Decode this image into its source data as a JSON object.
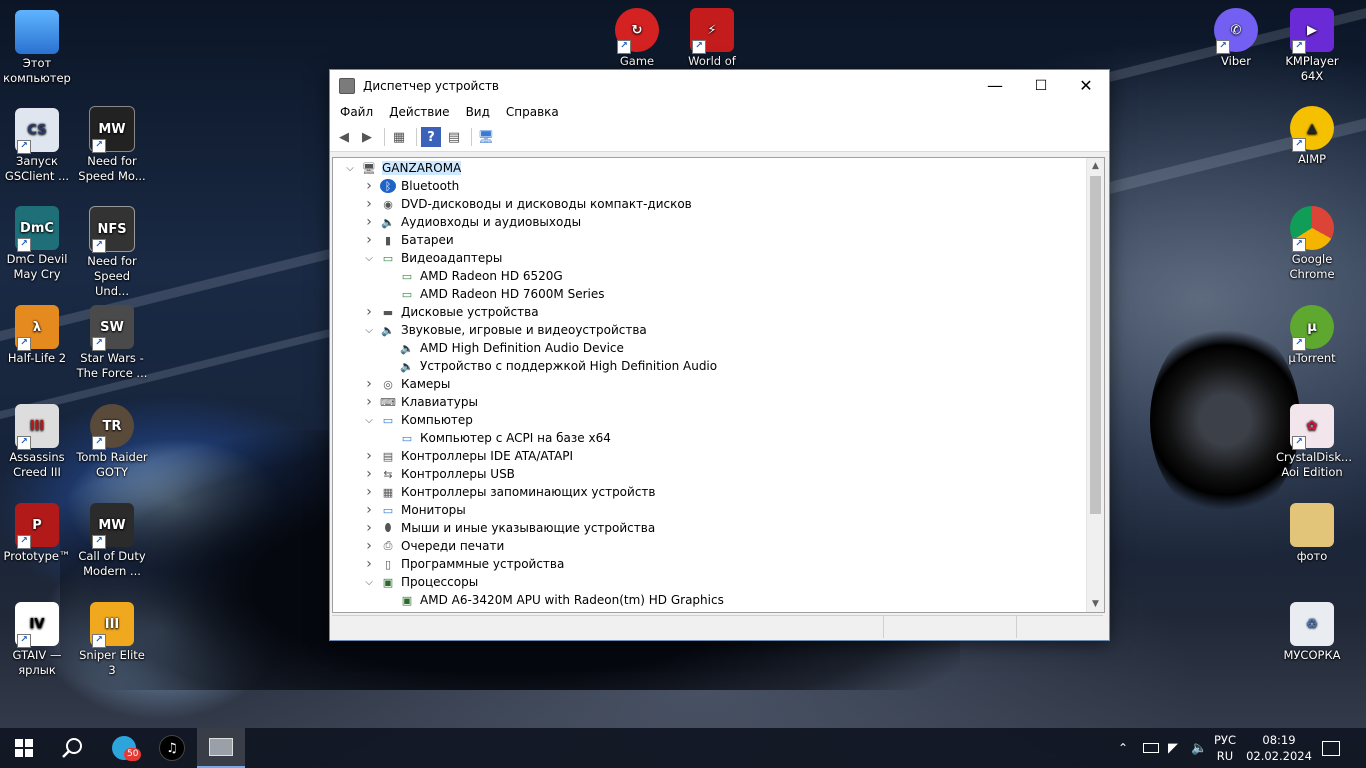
{
  "desktop": {
    "left_icons": [
      {
        "line1": "Этот",
        "line2": "компьютер",
        "icon": "computer-icon"
      },
      {
        "line1": "Запуск",
        "line2": "GSClient ...",
        "icon": "gsclient-icon"
      },
      {
        "line1": "Need for",
        "line2": "Speed Mo...",
        "icon": "nfs-most-wanted-icon"
      },
      {
        "line1": "DmC Devil",
        "line2": "May Cry",
        "icon": "dmc-icon"
      },
      {
        "line1": "Need for",
        "line2": "Speed Und...",
        "icon": "nfs-underground-icon"
      },
      {
        "line1": "Half-Life 2",
        "line2": "",
        "icon": "half-life-icon"
      },
      {
        "line1": "Star Wars -",
        "line2": "The Force ...",
        "icon": "star-wars-icon"
      },
      {
        "line1": "Assassins",
        "line2": "Creed III",
        "icon": "assassins-creed-icon"
      },
      {
        "line1": "Tomb Raider",
        "line2": "GOTY",
        "icon": "tomb-raider-icon"
      },
      {
        "line1": "Prototype™",
        "line2": "",
        "icon": "prototype-icon"
      },
      {
        "line1": "Call of Duty",
        "line2": "Modern ...",
        "icon": "call-of-duty-icon"
      },
      {
        "line1": "GTAIV —",
        "line2": "ярлык",
        "icon": "gta-iv-icon"
      },
      {
        "line1": "Sniper Elite 3",
        "line2": "",
        "icon": "sniper-elite-icon"
      }
    ],
    "top_icons": [
      {
        "line1": "Game Center",
        "line2": "",
        "icon": "game-center-icon"
      },
      {
        "line1": "World of",
        "line2": "",
        "icon": "world-of-tanks-icon"
      }
    ],
    "right_icons": [
      {
        "line1": "Viber",
        "line2": "",
        "icon": "viber-icon"
      },
      {
        "line1": "KMPlayer",
        "line2": "64X",
        "icon": "kmplayer-icon"
      },
      {
        "line1": "AIMP",
        "line2": "",
        "icon": "aimp-icon"
      },
      {
        "line1": "Google",
        "line2": "Chrome",
        "icon": "chrome-icon"
      },
      {
        "line1": "µTorrent",
        "line2": "",
        "icon": "utorrent-icon"
      },
      {
        "line1": "CrystalDisk...",
        "line2": "Aoi Edition",
        "icon": "crystaldisk-icon"
      },
      {
        "line1": "фото",
        "line2": "",
        "icon": "photo-folder-icon"
      },
      {
        "line1": "МУСОРКА",
        "line2": "",
        "icon": "recycle-bin-icon"
      }
    ]
  },
  "window": {
    "title": "Диспетчер устройств",
    "minimize": "—",
    "maximize": "☐",
    "close": "✕",
    "menu": [
      "Файл",
      "Действие",
      "Вид",
      "Справка"
    ],
    "toolbar": [
      "back-icon",
      "forward-icon",
      "properties-icon",
      "help-icon",
      "view-icon",
      "monitor-scan-icon"
    ]
  },
  "tree": [
    {
      "level": 0,
      "state": "open",
      "label": "GANZAROMA",
      "icon": "computer-icon",
      "selected": true
    },
    {
      "level": 1,
      "state": "closed",
      "label": "Bluetooth",
      "icon": "bluetooth-icon"
    },
    {
      "level": 1,
      "state": "closed",
      "label": "DVD-дисководы и дисководы компакт-дисков",
      "icon": "dvd-icon"
    },
    {
      "level": 1,
      "state": "closed",
      "label": "Аудиовходы и аудиовыходы",
      "icon": "speaker-icon"
    },
    {
      "level": 1,
      "state": "closed",
      "label": "Батареи",
      "icon": "battery-icon"
    },
    {
      "level": 1,
      "state": "open",
      "label": "Видеоадаптеры",
      "icon": "display-adapter-icon"
    },
    {
      "level": 2,
      "state": "none",
      "label": "AMD Radeon HD 6520G",
      "icon": "display-adapter-icon"
    },
    {
      "level": 2,
      "state": "none",
      "label": "AMD Radeon HD 7600M Series",
      "icon": "display-adapter-icon"
    },
    {
      "level": 1,
      "state": "closed",
      "label": "Дисковые устройства",
      "icon": "disk-icon"
    },
    {
      "level": 1,
      "state": "open",
      "label": "Звуковые, игровые и видеоустройства",
      "icon": "speaker-icon"
    },
    {
      "level": 2,
      "state": "none",
      "label": "AMD High Definition Audio Device",
      "icon": "speaker-icon"
    },
    {
      "level": 2,
      "state": "none",
      "label": "Устройство с поддержкой High Definition Audio",
      "icon": "speaker-icon"
    },
    {
      "level": 1,
      "state": "closed",
      "label": "Камеры",
      "icon": "camera-icon"
    },
    {
      "level": 1,
      "state": "closed",
      "label": "Клавиатуры",
      "icon": "keyboard-icon"
    },
    {
      "level": 1,
      "state": "open",
      "label": "Компьютер",
      "icon": "monitor-icon"
    },
    {
      "level": 2,
      "state": "none",
      "label": "Компьютер с ACPI на базе x64",
      "icon": "monitor-icon"
    },
    {
      "level": 1,
      "state": "closed",
      "label": "Контроллеры IDE ATA/ATAPI",
      "icon": "controller-icon"
    },
    {
      "level": 1,
      "state": "closed",
      "label": "Контроллеры USB",
      "icon": "usb-icon"
    },
    {
      "level": 1,
      "state": "closed",
      "label": "Контроллеры запоминающих устройств",
      "icon": "storage-controller-icon"
    },
    {
      "level": 1,
      "state": "closed",
      "label": "Мониторы",
      "icon": "monitor-icon"
    },
    {
      "level": 1,
      "state": "closed",
      "label": "Мыши и иные указывающие устройства",
      "icon": "mouse-icon"
    },
    {
      "level": 1,
      "state": "closed",
      "label": "Очереди печати",
      "icon": "printer-icon"
    },
    {
      "level": 1,
      "state": "closed",
      "label": "Программные устройства",
      "icon": "software-device-icon"
    },
    {
      "level": 1,
      "state": "open",
      "label": "Процессоры",
      "icon": "cpu-icon"
    },
    {
      "level": 2,
      "state": "none",
      "label": "AMD A6-3420M APU with Radeon(tm) HD Graphics",
      "icon": "cpu-icon"
    }
  ],
  "taskbar": {
    "start": "start-icon",
    "search": "search-icon",
    "telegram_badge": "50",
    "lang_top": "РУС",
    "lang_bottom": "RU",
    "time": "08:19",
    "date": "02.02.2024"
  }
}
